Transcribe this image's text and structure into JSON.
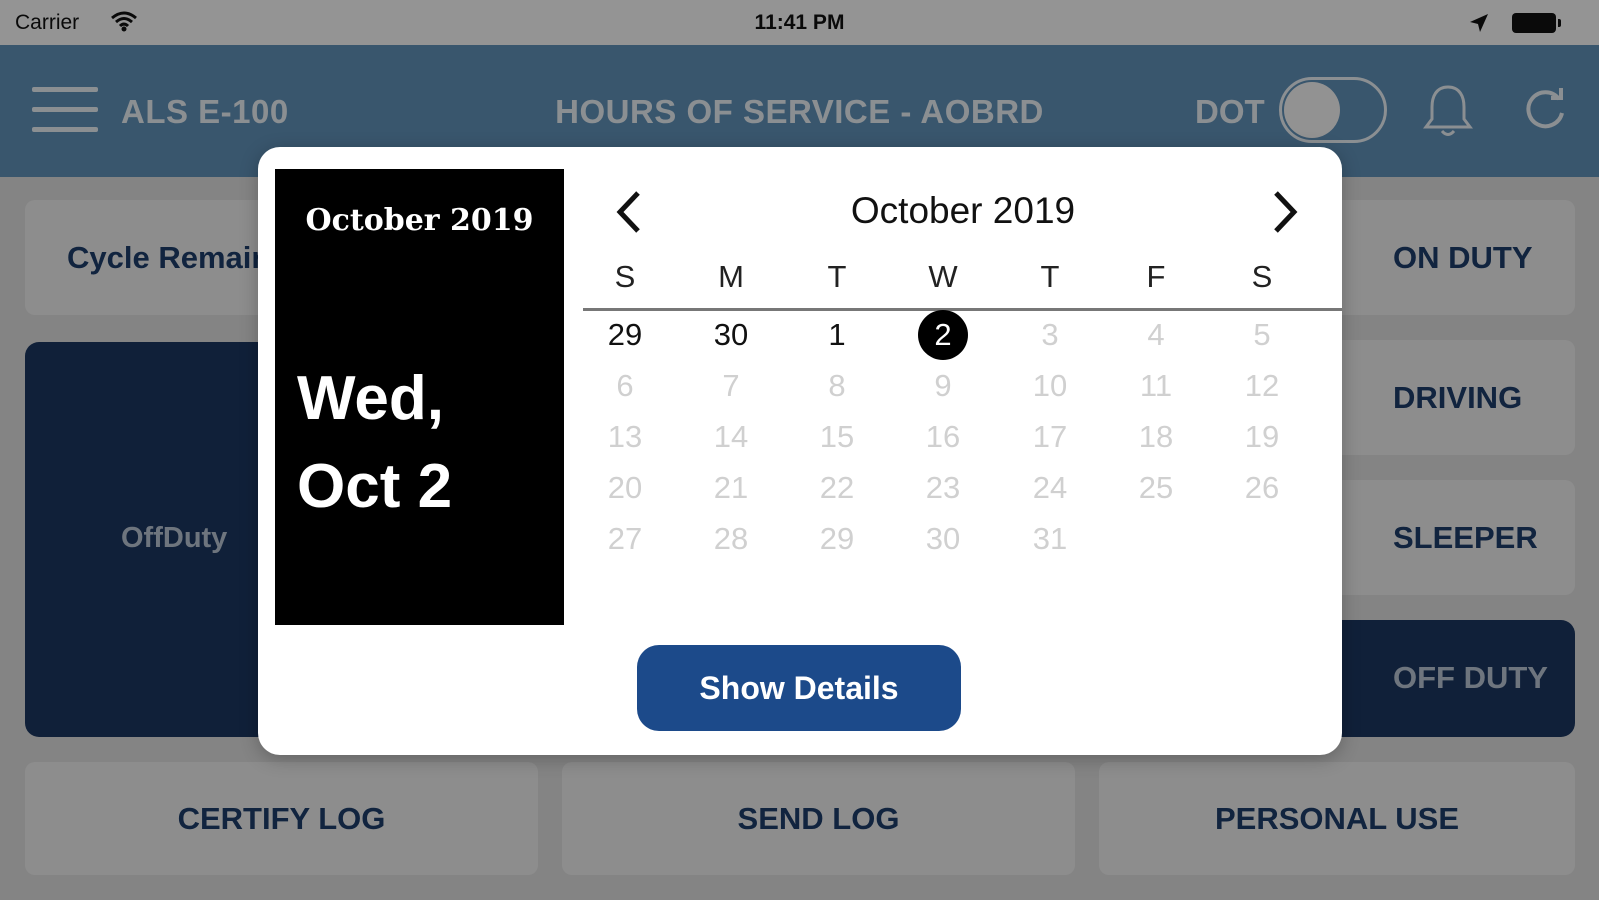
{
  "status_bar": {
    "carrier": "Carrier",
    "time": "11:41 PM"
  },
  "header": {
    "app_id": "ALS E-100",
    "title": "HOURS OF SERVICE - AOBRD",
    "dot_label": "DOT",
    "dot_toggle_on": false
  },
  "background": {
    "cycle_label": "Cycle Remaining",
    "current_status": "OffDuty",
    "duty_buttons": [
      "ON DUTY",
      "DRIVING",
      "SLEEPER",
      "OFF DUTY"
    ],
    "bottom_buttons": [
      "CERTIFY LOG",
      "SEND LOG",
      "PERSONAL USE"
    ]
  },
  "date_picker": {
    "header_year": "October 2019",
    "header_date_line1": "Wed,",
    "header_date_line2": "Oct 2",
    "month_title": "October 2019",
    "weekdays": [
      "S",
      "M",
      "T",
      "W",
      "T",
      "F",
      "S"
    ],
    "days": [
      [
        "29",
        "30",
        "1",
        "2",
        "3",
        "4",
        "5"
      ],
      [
        "6",
        "7",
        "8",
        "9",
        "10",
        "11",
        "12"
      ],
      [
        "13",
        "14",
        "15",
        "16",
        "17",
        "18",
        "19"
      ],
      [
        "20",
        "21",
        "22",
        "23",
        "24",
        "25",
        "26"
      ],
      [
        "27",
        "28",
        "29",
        "30",
        "31"
      ]
    ],
    "enabled_days": [
      "29",
      "30",
      "1",
      "2"
    ],
    "selected_day": "2",
    "button_label": "Show Details"
  },
  "colors": {
    "header_blue": "#5f8fb6",
    "navy": "#1c3660",
    "button_blue": "#1c4a8a",
    "selected_day_bg": "#000000",
    "disabled_day": "#d0d0d0"
  }
}
